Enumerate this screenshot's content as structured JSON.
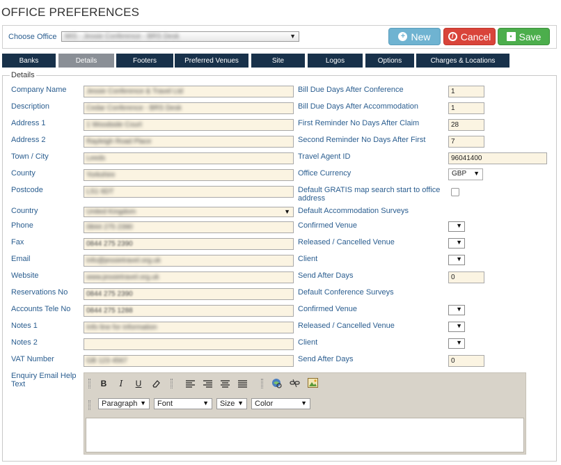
{
  "page": {
    "title": "OFFICE PREFERENCES"
  },
  "office": {
    "label": "Choose Office",
    "selected": "MIS - Jessie Conference - BRS Desk"
  },
  "actions": {
    "new_label": "New",
    "cancel_label": "Cancel",
    "save_label": "Save"
  },
  "tabs": [
    {
      "label": "Banks"
    },
    {
      "label": "Details"
    },
    {
      "label": "Footers"
    },
    {
      "label": "Preferred Venues"
    },
    {
      "label": "Site"
    },
    {
      "label": "Logos"
    },
    {
      "label": "Options"
    },
    {
      "label": "Charges & Locations"
    }
  ],
  "details": {
    "legend": "Details",
    "left": {
      "company_name": {
        "label": "Company Name",
        "value": "Jessie Conference & Travel Ltd"
      },
      "description": {
        "label": "Description",
        "value": "Cedar Conference - BRS Desk"
      },
      "address1": {
        "label": "Address 1",
        "value": "1 Woodside Court"
      },
      "address2": {
        "label": "Address 2",
        "value": "Rayleigh Road Place"
      },
      "town": {
        "label": "Town / City",
        "value": "Leeds"
      },
      "county": {
        "label": "County",
        "value": "Yorkshire"
      },
      "postcode": {
        "label": "Postcode",
        "value": "LS1 6DT"
      },
      "country": {
        "label": "Country",
        "value": "United Kingdom"
      },
      "phone": {
        "label": "Phone",
        "value": "0844 275 2390"
      },
      "fax": {
        "label": "Fax",
        "value": "0844 275 2390"
      },
      "email": {
        "label": "Email",
        "value": "info@jessietravel.org.uk"
      },
      "website": {
        "label": "Website",
        "value": "www.jessietravel.org.uk"
      },
      "reservations": {
        "label": "Reservations No",
        "value": "0844 275 2390"
      },
      "accounts_tel": {
        "label": "Accounts Tele No",
        "value": "0844 275 1288"
      },
      "notes1": {
        "label": "Notes 1",
        "value": "Info line for information"
      },
      "notes2": {
        "label": "Notes 2",
        "value": ""
      },
      "vat": {
        "label": "VAT Number",
        "value": "GB 123 4567"
      },
      "enquiry": {
        "label": "Enquiry Email Help Text"
      }
    },
    "right": {
      "bill_due_conf": {
        "label": "Bill Due Days After Conference",
        "value": "1"
      },
      "bill_due_accom": {
        "label": "Bill Due Days After Accommodation",
        "value": "1"
      },
      "first_reminder": {
        "label": "First Reminder No Days After Claim",
        "value": "28"
      },
      "second_reminder": {
        "label": "Second Reminder No Days After First",
        "value": "7"
      },
      "travel_agent": {
        "label": "Travel Agent ID",
        "value": "96041400"
      },
      "currency": {
        "label": "Office Currency",
        "value": "GBP"
      },
      "gratis": {
        "label": "Default GRATIS map search start to office address"
      },
      "accom_surveys": {
        "label": "Default Accommodation Surveys"
      },
      "accom_confirmed": {
        "label": "Confirmed Venue"
      },
      "accom_released": {
        "label": "Released / Cancelled Venue"
      },
      "accom_client": {
        "label": "Client"
      },
      "accom_send_after": {
        "label": "Send After Days",
        "value": "0"
      },
      "conf_surveys": {
        "label": "Default Conference Surveys"
      },
      "conf_confirmed": {
        "label": "Confirmed Venue"
      },
      "conf_released": {
        "label": "Released / Cancelled Venue"
      },
      "conf_client": {
        "label": "Client"
      },
      "conf_send_after": {
        "label": "Send After Days",
        "value": "0"
      }
    }
  },
  "editor": {
    "format": "Paragraph",
    "font": "Font",
    "size": "Size",
    "color": "Color",
    "buttons": [
      "B",
      "I",
      "U"
    ]
  }
}
